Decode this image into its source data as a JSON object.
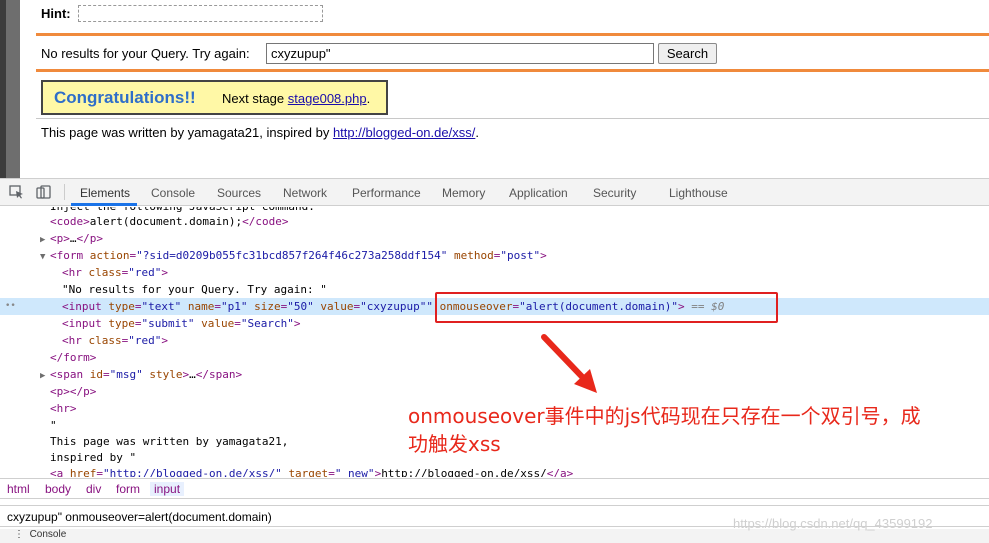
{
  "page": {
    "hint_label": "Hint:",
    "noresults_text": "No results for your Query. Try again:",
    "input_value": "cxyzupup\"",
    "search_label": "Search",
    "congrats_title": "Congratulations!!",
    "next_prefix": "Next stage",
    "next_link": "stage008.php",
    "next_suffix": ".",
    "written_prefix": "This page was written by yamagata21, inspired by",
    "written_link": "http://blogged-on.de/xss/",
    "written_suffix": "."
  },
  "devtools": {
    "tabs": [
      "Elements",
      "Console",
      "Sources",
      "Network",
      "Performance",
      "Memory",
      "Application",
      "Security",
      "Lighthouse"
    ],
    "active_tab": "Elements",
    "breadcrumbs": [
      "html",
      "body",
      "div",
      "form",
      "input"
    ],
    "console_value": "cxyzupup\" onmouseover=alert(document.domain)",
    "drawer_label": "Console"
  },
  "annotation": {
    "line1": "onmouseover事件中的js代码现在只存在一个双引号，成",
    "line2": "功触发xss"
  },
  "watermark": "https://blog.csdn.net/qq_43599192",
  "colors": {
    "orange_rule": "#f08a3c",
    "congrats_bg": "#fff8a6",
    "annotation_red": "#e8281b",
    "selected_row": "#cfe8fc"
  }
}
